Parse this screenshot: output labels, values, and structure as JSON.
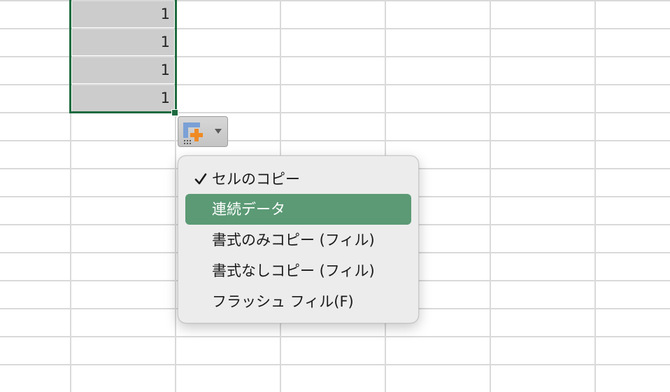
{
  "spreadsheet": {
    "selected_cells": [
      "1",
      "1",
      "1",
      "1"
    ]
  },
  "paste_options": {
    "button_icon": "autofill-options-icon",
    "arrow_icon": "chevron-down-icon"
  },
  "autofill_menu": {
    "items": [
      {
        "label": "セルのコピー",
        "checked": true,
        "highlighted": false
      },
      {
        "label": "連続データ",
        "checked": false,
        "highlighted": true
      },
      {
        "label": "書式のみコピー (フィル)",
        "checked": false,
        "highlighted": false
      },
      {
        "label": "書式なしコピー (フィル)",
        "checked": false,
        "highlighted": false
      },
      {
        "label": "フラッシュ フィル(F)",
        "checked": false,
        "highlighted": false
      }
    ]
  },
  "colors": {
    "selection_border": "#1d6b40",
    "menu_highlight": "#5b9a75",
    "selected_cell_fill": "#cccccc"
  }
}
